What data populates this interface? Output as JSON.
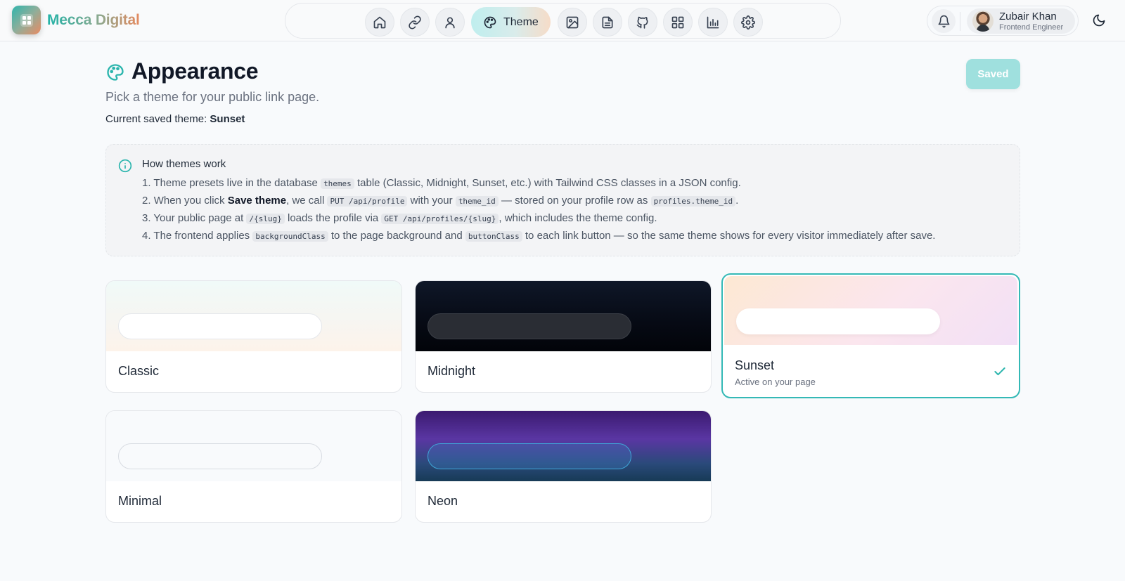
{
  "brand": {
    "name": "Mecca Digital"
  },
  "nav": {
    "active_label": "Theme",
    "items": [
      "home-icon",
      "link-icon",
      "user-icon",
      "palette-icon",
      "image-icon",
      "document-icon",
      "github-icon",
      "grid-icon",
      "chart-icon",
      "gear-icon"
    ]
  },
  "user": {
    "name": "Zubair Khan",
    "role": "Frontend Engineer"
  },
  "page": {
    "title": "Appearance",
    "subtitle": "Pick a theme for your public link page.",
    "current_label": "Current saved theme:",
    "current_value": "Sunset",
    "save_button": "Saved"
  },
  "info": {
    "title": "How themes work",
    "items": [
      {
        "n": "1.",
        "a": "Theme presets live in the database ",
        "code1": "themes",
        "b": " table (Classic, Midnight, Sunset, etc.) with Tailwind CSS classes in a JSON config."
      },
      {
        "n": "2.",
        "a": "When you click ",
        "strong": "Save theme",
        "b": ", we call ",
        "code1": "PUT /api/profile",
        "c": " with your ",
        "code2": "theme_id",
        "d": " — stored on your profile row as ",
        "code3": "profiles.theme_id",
        "e": "."
      },
      {
        "n": "3.",
        "a": "Your public page at ",
        "code1": "/{slug}",
        "b": " loads the profile via ",
        "code2": "GET /api/profiles/{slug}",
        "c": ", which includes the theme config."
      },
      {
        "n": "4.",
        "a": "The frontend applies ",
        "code1": "backgroundClass",
        "b": " to the page background and ",
        "code2": "buttonClass",
        "c": " to each link button — so the same theme shows for every visitor immediately after save."
      }
    ]
  },
  "themes": [
    {
      "name": "Classic"
    },
    {
      "name": "Midnight"
    },
    {
      "name": "Sunset",
      "status": "Active on your page"
    },
    {
      "name": "Minimal"
    },
    {
      "name": "Neon"
    }
  ],
  "colors": {
    "accent": "#34b9b6",
    "save_button": "#9fe0de"
  }
}
